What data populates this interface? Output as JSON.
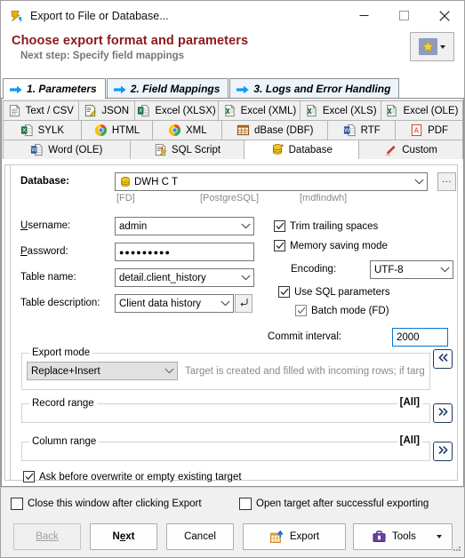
{
  "window": {
    "title": "Export to File or Database...",
    "icon": "export-app-icon",
    "minimize_label": "Minimize",
    "maximize_label": "Maximize",
    "close_label": "Close"
  },
  "header": {
    "title": "Choose export format and parameters",
    "subtitle": "Next step: Specify field mappings",
    "favorites_icon": "star-icon",
    "favorites_dropdown_icon": "chevron-down-icon"
  },
  "step_tabs": [
    {
      "label": "1. Parameters",
      "active": true,
      "icon": "blue-arrow-right-icon"
    },
    {
      "label": "2. Field Mappings",
      "active": false,
      "icon": "blue-arrow-right-icon"
    },
    {
      "label": "3. Logs and Error Handling",
      "active": false,
      "icon": "blue-arrow-right-icon"
    }
  ],
  "format_tabs": {
    "row1": [
      {
        "label": "Text / CSV",
        "icon": "text-file-icon",
        "active": false,
        "width": 103
      },
      {
        "label": "JSON",
        "icon": "json-file-icon",
        "active": false,
        "width": 77
      },
      {
        "label": "Excel (XLSX)",
        "icon": "excel-xlsx-icon",
        "active": false,
        "width": 115
      },
      {
        "label": "Excel (XML)",
        "icon": "excel-xml-icon",
        "active": false,
        "width": 112
      },
      {
        "label": "Excel (XLS)",
        "icon": "excel-xls-icon",
        "active": false,
        "width": 110
      },
      {
        "label": "Excel (OLE)",
        "icon": "excel-ole-icon",
        "active": false,
        "width": 112
      }
    ],
    "row2": [
      {
        "label": "SYLK",
        "icon": "sylk-file-icon",
        "active": false,
        "width": 90
      },
      {
        "label": "HTML",
        "icon": "chrome-icon",
        "active": false,
        "width": 83
      },
      {
        "label": "XML",
        "icon": "chrome-icon",
        "active": false,
        "width": 80
      },
      {
        "label": "dBase (DBF)",
        "icon": "dbase-table-icon",
        "active": false,
        "width": 122
      },
      {
        "label": "RTF",
        "icon": "word-rtf-icon",
        "active": false,
        "width": 78
      },
      {
        "label": "PDF",
        "icon": "pdf-file-icon",
        "active": false,
        "width": 78
      }
    ],
    "row3": [
      {
        "label": "Word (OLE)",
        "icon": "word-doc-icon",
        "active": false,
        "width": 145
      },
      {
        "label": "SQL Script",
        "icon": "sql-script-icon",
        "active": false,
        "width": 131
      },
      {
        "label": "Database",
        "icon": "database-icon",
        "active": true,
        "width": 131
      },
      {
        "label": "Custom",
        "icon": "pencil-icon",
        "active": false,
        "width": 119
      }
    ]
  },
  "form": {
    "database_label": "Database:",
    "database_value": "DWH C T",
    "database_icon": "database-icon",
    "database_dropdown_icon": "chevron-down-icon",
    "database_browse_label": "...",
    "sub_driver": "[FD]",
    "sub_engine": "[PostgreSQL]",
    "sub_name": "[mdfindwh]",
    "username_label": "Username:",
    "username_value": "admin",
    "password_label": "Password:",
    "password_value": "●●●●●●●●●",
    "table_name_label": "Table name:",
    "table_name_value": "detail.client_history",
    "table_description_label": "Table description:",
    "table_description_value": "Client data history",
    "table_description_revert_icon": "undo-arrow-icon",
    "trim_trailing_spaces": {
      "label": "Trim trailing spaces",
      "checked": true
    },
    "memory_saving_mode": {
      "label": "Memory saving mode",
      "checked": true
    },
    "encoding_label": "Encoding:",
    "encoding_value": "UTF-8",
    "use_sql_parameters": {
      "label": "Use SQL parameters",
      "checked": true
    },
    "batch_mode": {
      "label": "Batch mode (FD)",
      "checked": true,
      "disabled": true
    },
    "commit_interval_label": "Commit interval:",
    "commit_interval_value": "2000"
  },
  "export_mode": {
    "group_title": "Export mode",
    "value": "Replace+Insert",
    "hint": "Target is created and filled with incoming rows; if target...",
    "collapse_icon": "double-chevron-left-icon"
  },
  "record_range": {
    "group_title": "Record range",
    "value": "[All]",
    "expand_icon": "double-chevron-right-icon"
  },
  "column_range": {
    "group_title": "Column range",
    "value": "[All]",
    "expand_icon": "double-chevron-right-icon"
  },
  "ask_before_overwrite": {
    "label": "Ask before overwrite or empty existing target",
    "checked": true
  },
  "footer": {
    "close_window_after_export": {
      "label": "Close this window after clicking Export",
      "checked": false
    },
    "open_target_after_export": {
      "label": "Open target after successful exporting",
      "checked": false
    },
    "buttons": {
      "back": "Back",
      "next_pre": "N",
      "next_key": "e",
      "next_post": "xt",
      "cancel": "Cancel",
      "export": "Export",
      "tools": "Tools"
    },
    "export_icon": "export-table-icon",
    "tools_icon": "toolbox-icon",
    "tools_dropdown_icon": "chevron-down-icon"
  },
  "colors": {
    "header_title": "#8b1a1a",
    "header_subtitle": "#767676",
    "accent_blue": "#0078d7",
    "nav_button": "#1f3864",
    "close_hover": "#e81123"
  }
}
